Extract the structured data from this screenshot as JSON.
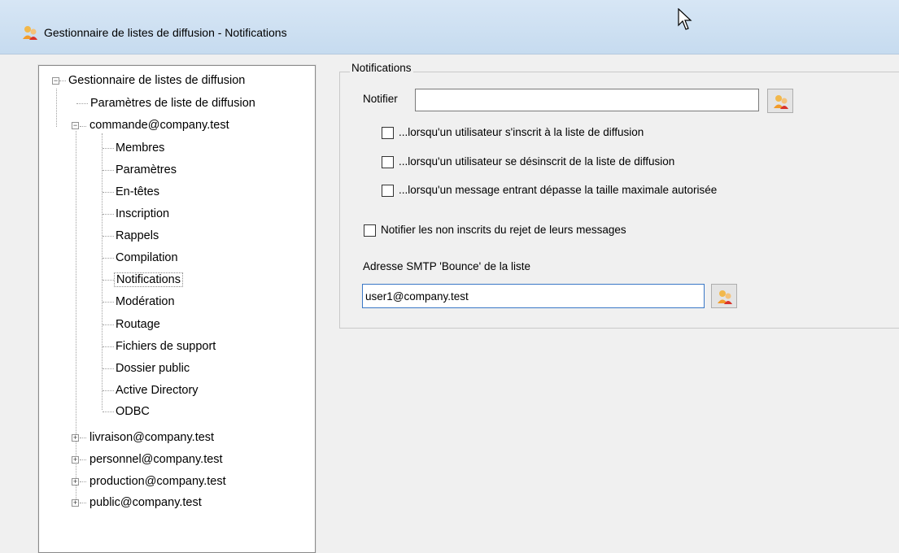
{
  "window": {
    "title": "Gestionnaire de listes de diffusion - Notifications",
    "icon": "people-icon"
  },
  "tree": {
    "root": "Gestionnaire de listes de diffusion",
    "root_child": "Paramètres de liste de diffusion",
    "list1": {
      "label": "commande@company.test",
      "children": [
        "Membres",
        "Paramètres",
        "En-têtes",
        "Inscription",
        "Rappels",
        "Compilation",
        "Notifications",
        "Modération",
        "Routage",
        "Fichiers de support",
        "Dossier public",
        "Active Directory",
        "ODBC"
      ],
      "selected": "Notifications"
    },
    "other_lists": [
      "livraison@company.test",
      "personnel@company.test",
      "production@company.test",
      "public@company.test"
    ]
  },
  "notifications": {
    "group_title": "Notifications",
    "notify_label": "Notifier",
    "notify_value": "",
    "options": [
      {
        "label": "...lorsqu'un utilisateur s'inscrit à la liste de diffusion",
        "checked": false
      },
      {
        "label": "...lorsqu'un utilisateur se désinscrit de la liste de diffusion",
        "checked": false
      },
      {
        "label": "...lorsqu'un message entrant dépasse la taille maximale autorisée",
        "checked": false
      }
    ],
    "notify_non_members": {
      "label": "Notifier les non inscrits du rejet de leurs messages",
      "checked": false
    },
    "bounce_label": "Adresse SMTP 'Bounce' de la liste",
    "bounce_value": "user1@company.test"
  }
}
